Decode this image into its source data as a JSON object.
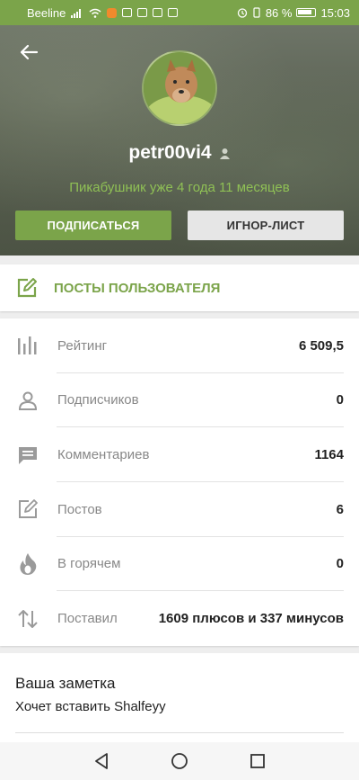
{
  "status_bar": {
    "carrier": "Beeline",
    "battery": "86 %",
    "time": "15:03"
  },
  "profile": {
    "username": "petr00vi4",
    "since": "Пикабушник уже 4 года 11 месяцев",
    "subscribe_label": "ПОДПИСАТЬСЯ",
    "ignore_label": "ИГНОР-ЛИСТ"
  },
  "posts_link": {
    "label": "ПОСТЫ ПОЛЬЗОВАТЕЛЯ"
  },
  "stats": [
    {
      "icon": "rating-icon",
      "label": "Рейтинг",
      "value": "6 509,5"
    },
    {
      "icon": "person-icon",
      "label": "Подписчиков",
      "value": "0"
    },
    {
      "icon": "comment-icon",
      "label": "Комментариев",
      "value": "1164"
    },
    {
      "icon": "edit-icon",
      "label": "Постов",
      "value": "6"
    },
    {
      "icon": "fire-icon",
      "label": "В горячем",
      "value": "0"
    },
    {
      "icon": "sort-arrows-icon",
      "label": "Поставил",
      "value": "1609 плюсов и 337 минусов"
    }
  ],
  "note": {
    "title": "Ваша заметка",
    "text": "Хочет вставить Shalfeyy"
  },
  "colors": {
    "accent": "#7ba44a",
    "accent_text": "#8fc055",
    "header_bg": "#5a6152"
  }
}
